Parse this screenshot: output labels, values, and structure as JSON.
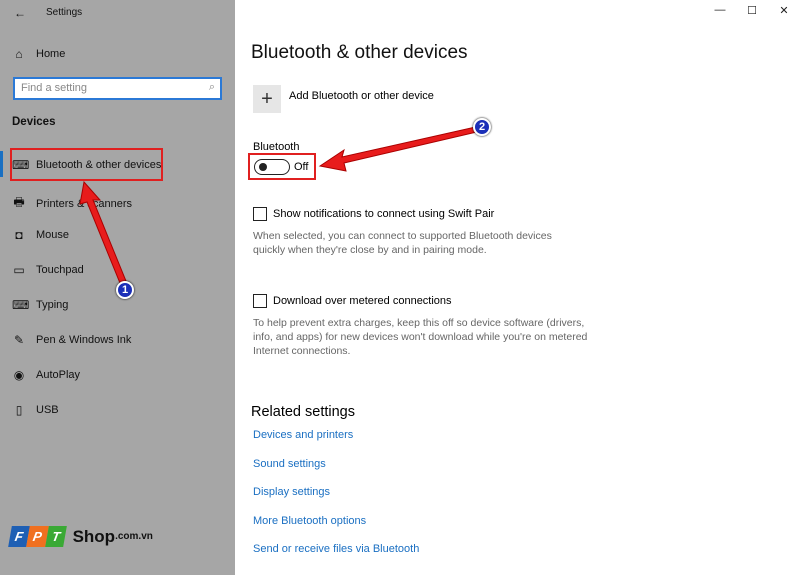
{
  "window": {
    "title": "Settings",
    "controls": [
      "—",
      "☐",
      "✕"
    ]
  },
  "sidebar": {
    "home": "Home",
    "search_placeholder": "Find a setting",
    "section": "Devices",
    "items": [
      {
        "label": "Bluetooth & other devices",
        "icon": "⌨"
      },
      {
        "label": "Printers & scanners",
        "icon": "🖶"
      },
      {
        "label": "Mouse",
        "icon": "◘"
      },
      {
        "label": "Touchpad",
        "icon": "▭"
      },
      {
        "label": "Typing",
        "icon": "⌨"
      },
      {
        "label": "Pen & Windows Ink",
        "icon": "✎"
      },
      {
        "label": "AutoPlay",
        "icon": "◉"
      },
      {
        "label": "USB",
        "icon": "▯"
      }
    ]
  },
  "main": {
    "title": "Bluetooth & other devices",
    "add_label": "Add Bluetooth or other device",
    "bluetooth_label": "Bluetooth",
    "toggle_state": "Off",
    "swift_pair_label": "Show notifications to connect using Swift Pair",
    "swift_pair_desc": "When selected, you can connect to supported Bluetooth devices quickly when they're close by and in pairing mode.",
    "metered_label": "Download over metered connections",
    "metered_desc": "To help prevent extra charges, keep this off so device software (drivers, info, and apps) for new devices won't download while you're on metered Internet connections.",
    "related_title": "Related settings",
    "related": [
      "Devices and printers",
      "Sound settings",
      "Display settings",
      "More Bluetooth options",
      "Send or receive files via Bluetooth"
    ]
  },
  "annotations": {
    "badge1": "1",
    "badge2": "2"
  },
  "logo": {
    "fpt": "FPT",
    "shop": "Shop",
    ".com.vn": ".com.vn"
  }
}
